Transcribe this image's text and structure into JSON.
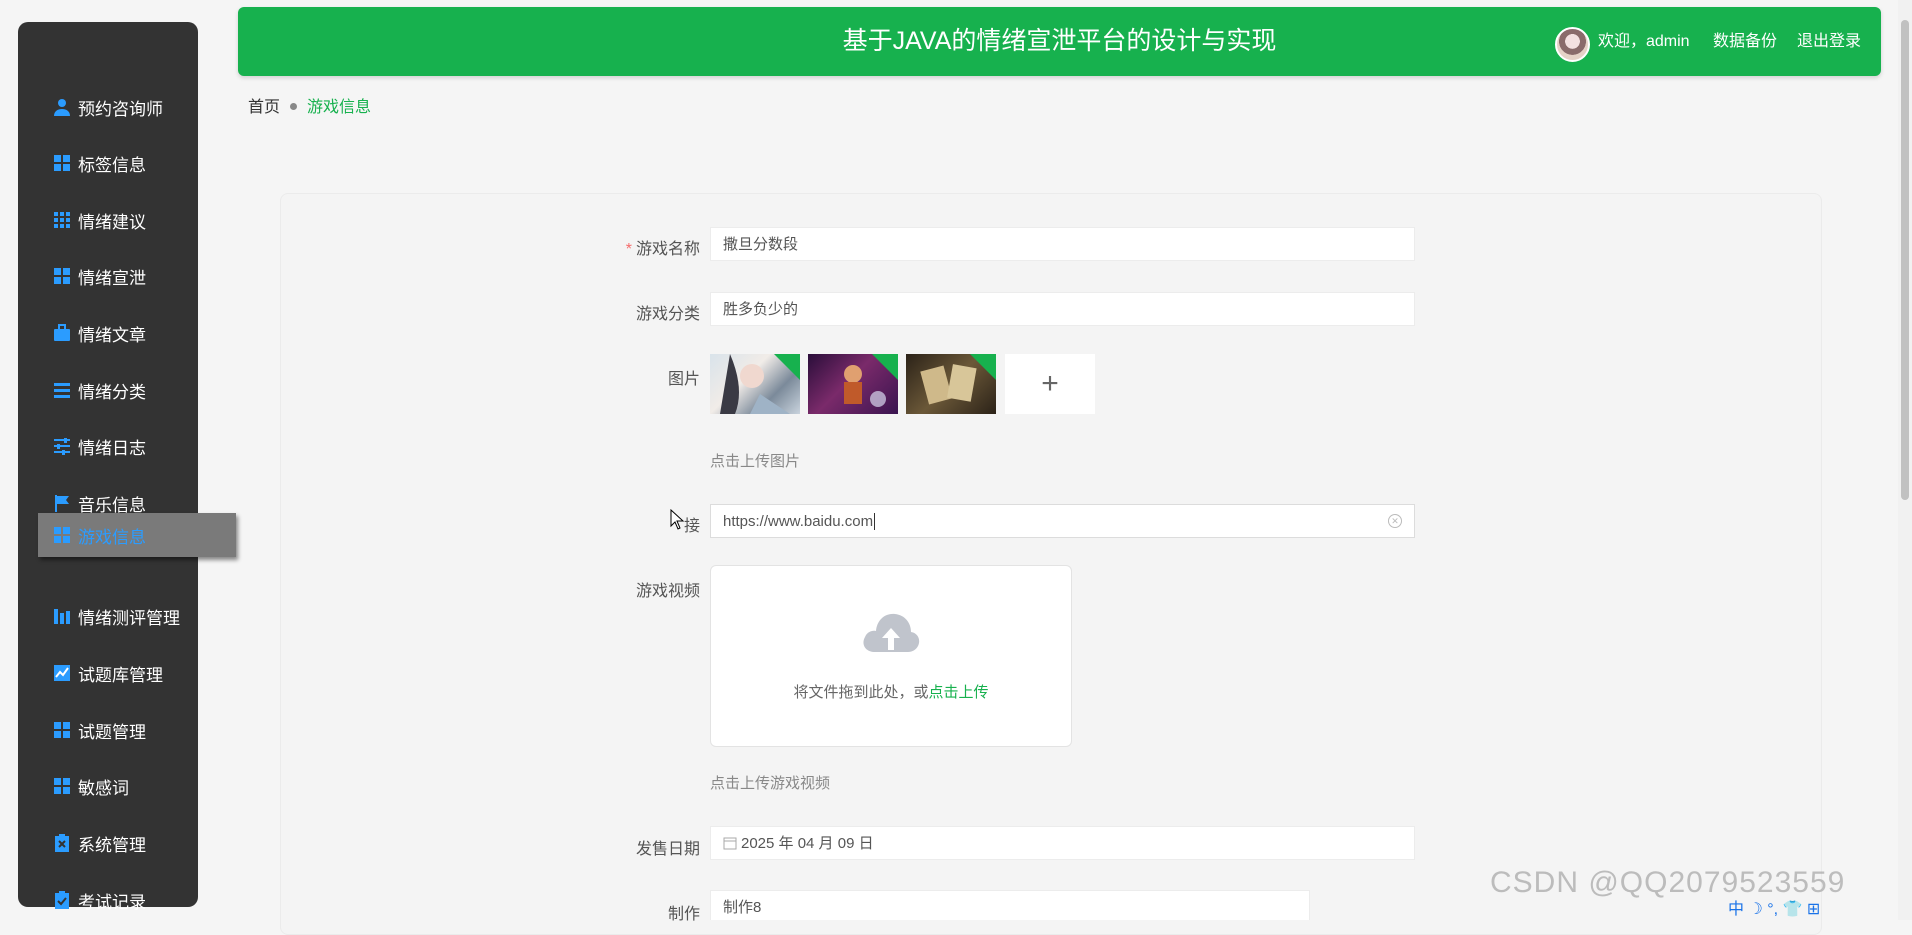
{
  "header": {
    "title": "基于JAVA的情绪宣泄平台的设计与实现",
    "welcome": "欢迎，admin",
    "backup": "数据备份",
    "logout": "退出登录"
  },
  "sidebar": {
    "items": [
      {
        "label": "预约咨询师",
        "icon": "user-icon"
      },
      {
        "label": "标签信息",
        "icon": "grid-icon"
      },
      {
        "label": "情绪建议",
        "icon": "apps-icon"
      },
      {
        "label": "情绪宣泄",
        "icon": "grid-icon"
      },
      {
        "label": "情绪文章",
        "icon": "briefcase-icon"
      },
      {
        "label": "情绪分类",
        "icon": "list-icon"
      },
      {
        "label": "情绪日志",
        "icon": "sliders-icon"
      },
      {
        "label": "音乐信息",
        "icon": "flag-icon"
      },
      {
        "label": "游戏信息",
        "icon": "grid-icon"
      },
      {
        "label": "情绪测评管理",
        "icon": "bar-chart-icon"
      },
      {
        "label": "试题库管理",
        "icon": "line-chart-icon"
      },
      {
        "label": "试题管理",
        "icon": "grid-icon"
      },
      {
        "label": "敏感词",
        "icon": "grid-icon"
      },
      {
        "label": "系统管理",
        "icon": "clipboard-x-icon"
      },
      {
        "label": "考试记录",
        "icon": "clipboard-check-icon"
      }
    ],
    "active_index": 8
  },
  "breadcrumb": {
    "home": "首页",
    "current": "游戏信息"
  },
  "form": {
    "name_label": "游戏名称",
    "name_value": "撒旦分数段",
    "category_label": "游戏分类",
    "category_value": "胜多负少的",
    "image_label": "图片",
    "image_hint": "点击上传图片",
    "link_label": "链接",
    "link_visible_label": "接",
    "link_value": "https://www.baidu.com",
    "video_label": "游戏视频",
    "video_drop_text": "将文件拖到此处，或",
    "video_drop_link": "点击上传",
    "video_hint": "点击上传游戏视频",
    "date_label": "发售日期",
    "date_value": "2025 年 04 月 09 日",
    "maker_label": "制作",
    "maker_value": "制作8"
  },
  "watermark": "CSDN @QQ2079523559",
  "tray": "中 ☽ °, 👕 ⊞",
  "colors": {
    "accent": "#17b14e",
    "sidebar": "#333333",
    "active_text": "#2b9cff"
  }
}
